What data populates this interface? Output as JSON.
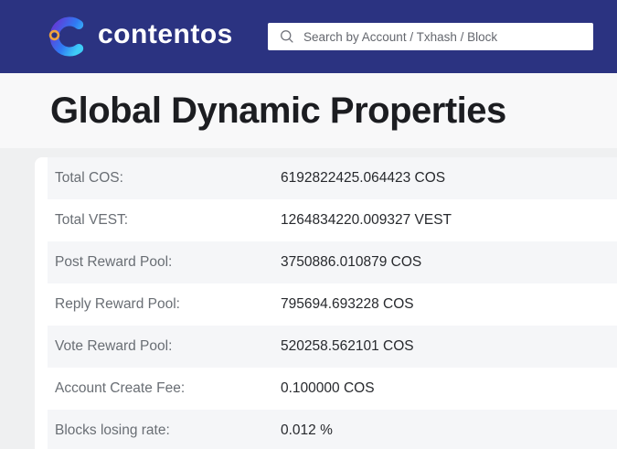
{
  "header": {
    "brand": "contentos",
    "search": {
      "placeholder": "Search by Account / Txhash / Block"
    }
  },
  "page": {
    "title": "Global Dynamic Properties"
  },
  "properties": [
    {
      "label": "Total COS:",
      "value": "6192822425.064423 COS"
    },
    {
      "label": "Total VEST:",
      "value": "1264834220.009327 VEST"
    },
    {
      "label": "Post Reward Pool:",
      "value": "3750886.010879 COS"
    },
    {
      "label": "Reply Reward Pool:",
      "value": "795694.693228 COS"
    },
    {
      "label": "Vote Reward Pool:",
      "value": "520258.562101 COS"
    },
    {
      "label": "Account Create Fee:",
      "value": "0.100000 COS"
    },
    {
      "label": "Blocks losing rate:",
      "value": "0.012 %"
    }
  ],
  "icons": {
    "logo": "contentos-c-mark",
    "search": "magnifier"
  },
  "colors": {
    "header_bg": "#2b3381",
    "title_band_bg": "#f8f8f9",
    "page_bg": "#eff0f1",
    "card_bg": "#ffffff",
    "row_stripe": "#f5f6f8",
    "label_color": "#696e74",
    "value_color": "#27292d",
    "title_color": "#1c1d21",
    "placeholder_color": "#64676e",
    "logo_cyan": "#3ecdf7",
    "logo_blue": "#2f7bf4",
    "logo_purple": "#5e3fd8",
    "logo_orange": "#f0a43e"
  }
}
